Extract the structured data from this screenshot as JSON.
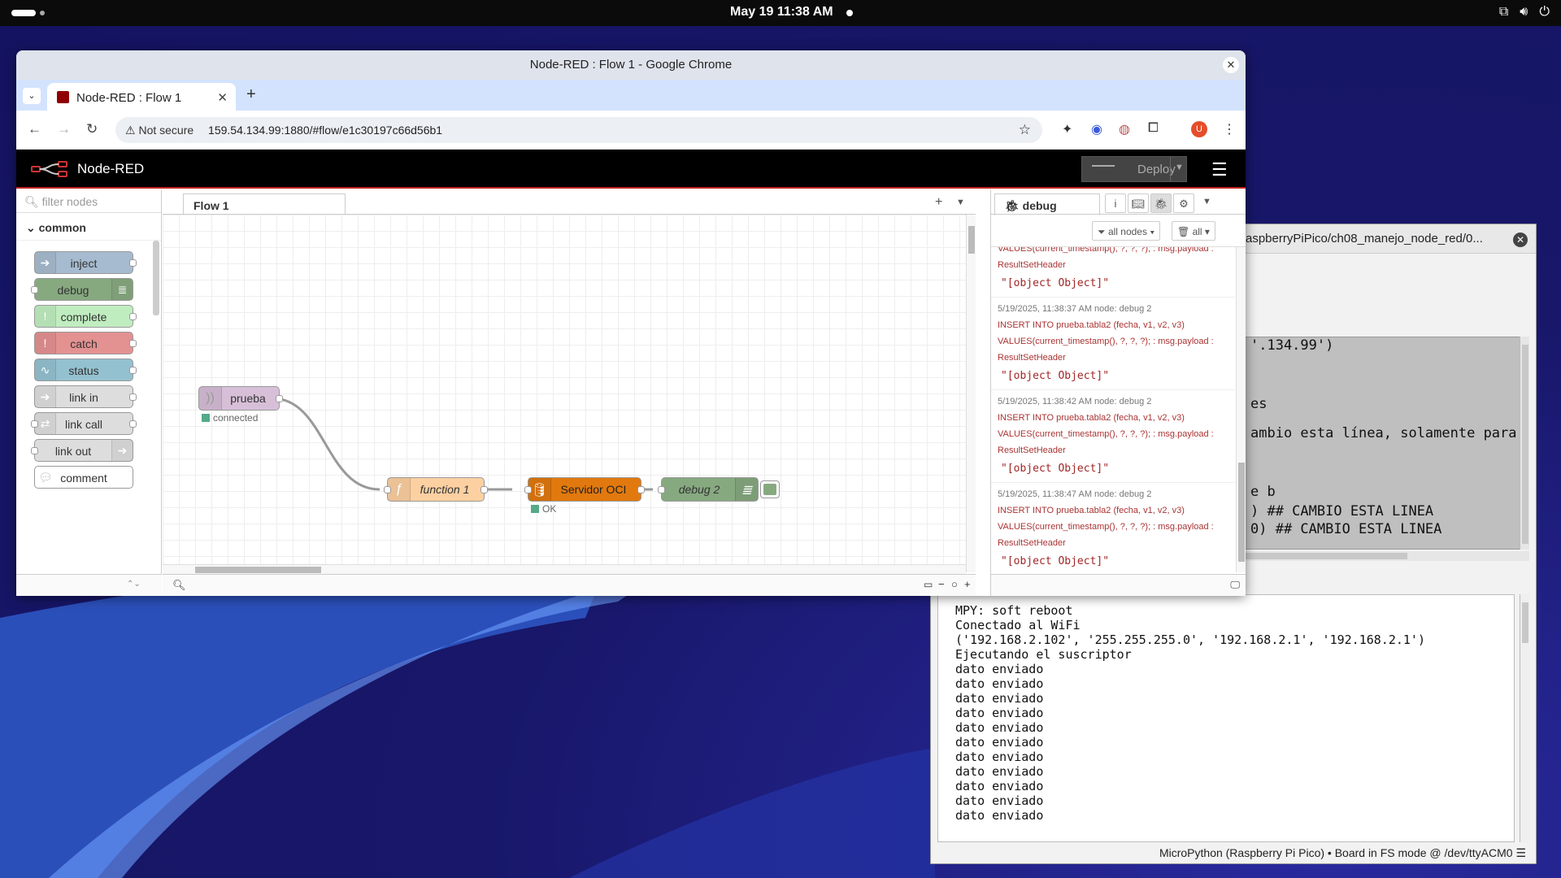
{
  "system": {
    "clock": "May 19  11:38 AM",
    "tray_icons": [
      "network-icon",
      "volume-icon",
      "power-icon"
    ]
  },
  "chrome": {
    "window_title": "Node-RED : Flow 1 - Google Chrome",
    "tab_title": "Node-RED : Flow 1",
    "security_label": "Not secure",
    "url": "159.54.134.99:1880/#flow/e1c30197c66d56b1",
    "avatar_letter": "U"
  },
  "nodered": {
    "brand": "Node-RED",
    "deploy_label": "Deploy",
    "palette": {
      "filter_placeholder": "filter nodes",
      "category": "common",
      "nodes": [
        "inject",
        "debug",
        "complete",
        "catch",
        "status",
        "link in",
        "link call",
        "link out",
        "comment"
      ]
    },
    "flow_tab": "Flow 1",
    "flow_nodes": {
      "mqtt_in": {
        "label": "prueba",
        "status": "connected"
      },
      "function": {
        "label": "function 1"
      },
      "db": {
        "label": "Servidor OCI",
        "status": "OK"
      },
      "debug": {
        "label": "debug 2"
      }
    },
    "debug": {
      "tab_label": "debug",
      "filter_nodes": "all nodes",
      "filter_clear": "all",
      "partial_top": {
        "line1": "VALUES(current_timestamp(), ?, ?, ?); : msg.payload :",
        "line2": "ResultSetHeader",
        "value": "\"[object Object]\""
      },
      "messages": [
        {
          "meta": "5/19/2025, 11:38:37 AM    node: debug 2",
          "line1": "INSERT INTO prueba.tabla2 (fecha, v1, v2, v3)",
          "line2": "VALUES(current_timestamp(), ?, ?, ?); : msg.payload :",
          "line3": "ResultSetHeader",
          "value": "\"[object Object]\""
        },
        {
          "meta": "5/19/2025, 11:38:42 AM    node: debug 2",
          "line1": "INSERT INTO prueba.tabla2 (fecha, v1, v2, v3)",
          "line2": "VALUES(current_timestamp(), ?, ?, ?); : msg.payload :",
          "line3": "ResultSetHeader",
          "value": "\"[object Object]\""
        },
        {
          "meta": "5/19/2025, 11:38:47 AM    node: debug 2",
          "line1": "INSERT INTO prueba.tabla2 (fecha, v1, v2, v3)",
          "line2": "VALUES(current_timestamp(), ?, ?, ?); : msg.payload :",
          "line3": "ResultSetHeader",
          "value": "\"[object Object]\""
        }
      ]
    }
  },
  "thonny": {
    "title": "aspberryPiPico/ch08_manejo_node_red/0...",
    "editor_lines": [
      "'.134.99')",
      "es",
      "ambio esta línea, solamente para",
      "e b",
      ") ## CAMBIO ESTA LINEA",
      "0) ## CAMBIO ESTA LINEA"
    ],
    "shell_lines": [
      "MPY: soft reboot",
      "Conectado al WiFi",
      "('192.168.2.102', '255.255.255.0', '192.168.2.1', '192.168.2.1')",
      "Ejecutando el suscriptor",
      "dato enviado",
      "dato enviado",
      "dato enviado",
      "dato enviado",
      "dato enviado",
      "dato enviado",
      "dato enviado",
      "dato enviado",
      "dato enviado",
      "dato enviado",
      "dato enviado"
    ],
    "status": "MicroPython (Raspberry Pi Pico)  •  Board in FS mode @ /dev/ttyACM0  ☰"
  }
}
